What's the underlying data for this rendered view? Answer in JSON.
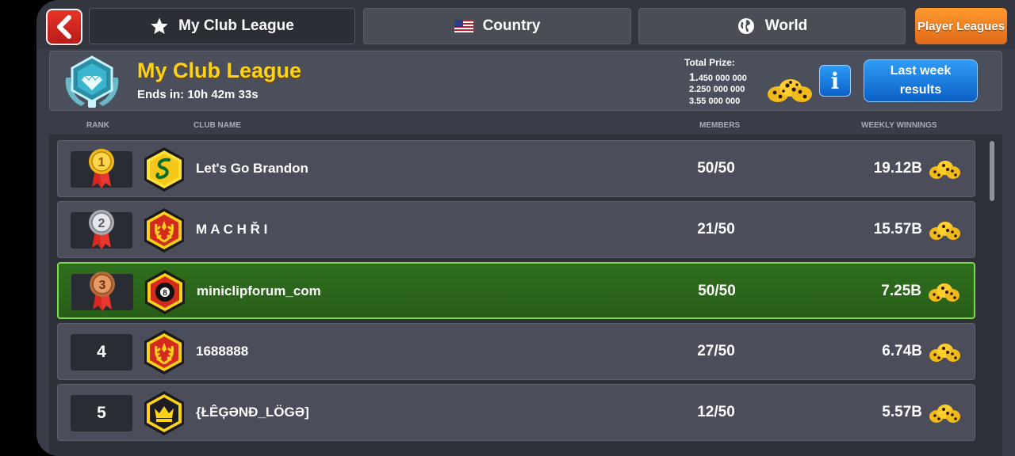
{
  "topbar": {
    "tabs": [
      {
        "label": "My Club League",
        "icon": "star-icon",
        "active": true
      },
      {
        "label": "Country",
        "icon": "us-flag-icon",
        "active": false
      },
      {
        "label": "World",
        "icon": "globe-icon",
        "active": false
      }
    ],
    "player_leagues_label": "Player Leagues"
  },
  "header": {
    "title": "My Club League",
    "ends_in": "Ends in: 10h 42m 33s",
    "total_prize_label": "Total Prize:",
    "prizes": [
      {
        "lead": "1.",
        "rest": "450 000 000"
      },
      {
        "lead": "",
        "rest": "2.250 000 000"
      },
      {
        "lead": "",
        "rest": "3.55 000 000"
      }
    ],
    "info_label": "i",
    "last_week_label": "Last week results"
  },
  "columns": {
    "rank": "RANK",
    "club_name": "CLUB NAME",
    "members": "MEMBERS",
    "weekly_winnings": "WEEKLY WINNINGS"
  },
  "rows": [
    {
      "rank": "1",
      "medal": "gold",
      "club": "Let's Go Brandon",
      "badge": "yellow-snake",
      "members": "50/50",
      "winnings": "19.12B",
      "highlight": false
    },
    {
      "rank": "2",
      "medal": "silver",
      "club": "M A C H Ř I",
      "badge": "red-laurel",
      "members": "21/50",
      "winnings": "15.57B",
      "highlight": false
    },
    {
      "rank": "3",
      "medal": "bronze",
      "club": "miniclipforum_com",
      "badge": "red-8ball",
      "members": "50/50",
      "winnings": "7.25B",
      "highlight": true
    },
    {
      "rank": "4",
      "medal": "",
      "club": "1688888",
      "badge": "red-laurel",
      "members": "27/50",
      "winnings": "6.74B",
      "highlight": false
    },
    {
      "rank": "5",
      "medal": "",
      "club": "{ŁÊĢƏNÐ_LÖGƏ]",
      "badge": "yellow-crown",
      "members": "12/50",
      "winnings": "5.57B",
      "highlight": false
    }
  ],
  "colors": {
    "accent_yellow": "#ffd21a",
    "highlight_green": "#2f6e1e",
    "button_blue": "#1a7fe0",
    "back_red": "#d8281f",
    "orange": "#f08a24"
  }
}
